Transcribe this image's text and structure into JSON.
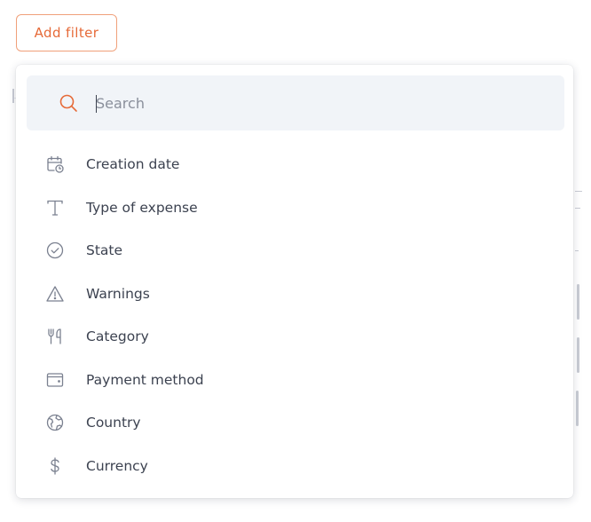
{
  "toolbar": {
    "add_filter_label": "Add filter"
  },
  "search": {
    "placeholder": "Search",
    "value": ""
  },
  "filters": [
    {
      "label": "Creation date",
      "icon": "calendar-clock-icon"
    },
    {
      "label": "Type of expense",
      "icon": "text-type-icon"
    },
    {
      "label": "State",
      "icon": "check-circle-icon"
    },
    {
      "label": "Warnings",
      "icon": "warning-triangle-icon"
    },
    {
      "label": "Category",
      "icon": "fork-knife-icon"
    },
    {
      "label": "Payment method",
      "icon": "wallet-icon"
    },
    {
      "label": "Country",
      "icon": "globe-icon"
    },
    {
      "label": "Currency",
      "icon": "dollar-icon"
    }
  ],
  "colors": {
    "accent": "#e66a38",
    "accent_border": "#f0a07a",
    "search_bg": "#f1f4f8",
    "text": "#3c4250",
    "icon": "#7b8190"
  }
}
